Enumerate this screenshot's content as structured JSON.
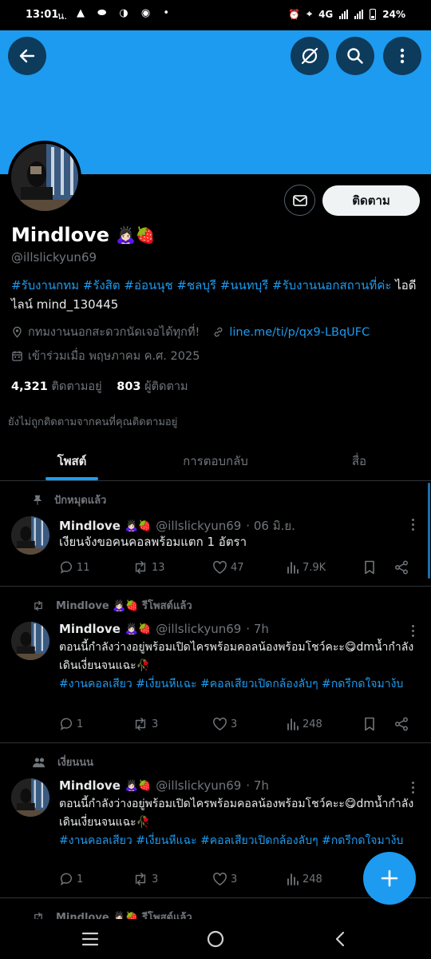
{
  "status": {
    "time": "13:01",
    "carrier_label": "น.",
    "network": "4G",
    "battery": "24%"
  },
  "profile": {
    "name": "Mindlove",
    "name_emoji": "🙇🏻‍♀️🍓",
    "handle": "@illslickyun69",
    "follow_label": "ติดตาม",
    "bio_tags": "#รับงานกทม #รังสิต #อ่อนนุช #ชลบุรี #นนทบุรี #รับงานนอกสถานที่ค่ะ",
    "bio_rest": " ไอดีไลน์ mind_130445",
    "location": "กทมงานนอกสะดวกนัดเจอได้ทุกที่!",
    "link": "line.me/ti/p/qx9-LBqUFC",
    "joined": "เข้าร่วมเมื่อ พฤษภาคม ค.ศ. 2025",
    "following_count": "4,321",
    "following_label": "ติดตามอยู่",
    "followers_count": "803",
    "followers_label": "ผู้ติดตาม",
    "not_followed_note": "ยังไม่ถูกติดตามจากคนที่คุณติดตามอยู่"
  },
  "tabs": [
    {
      "label": "โพสต์"
    },
    {
      "label": "การตอบกลับ"
    },
    {
      "label": "สื่อ"
    }
  ],
  "posts": [
    {
      "context": "ปักหมุดแล้ว",
      "name": "Mindlove",
      "emoji": "🙇🏻‍♀️🍓",
      "handle": "@illslickyun69",
      "time": "· 06 มิ.ย.",
      "text": "เงียนจังขอคนคอลพร้อมแตก 1 อัตรา",
      "tags": "",
      "replies": "11",
      "reposts": "13",
      "likes": "47",
      "views": "7.9K"
    },
    {
      "context": "Mindlove 🙇🏻‍♀️🍓 รีโพสต์แล้ว",
      "name": "Mindlove",
      "emoji": "🙇🏻‍♀️🍓",
      "handle": "@illslickyun69",
      "time": "· 7h",
      "text": "ตอนนี้กำลังว่างอยู่พร้อมเปิดไครพร้อมคอลน้องพร้อมโชว์คะะ😋dmน้ำกำลังเดินเงี่ยนจนแฉะ🥀",
      "tags": "#งานคอลเสียว #เงี่ยนหีแฉะ #คอลเสียวเปิดกล้องลับๆ #กดรีกดใจมาง้บ",
      "replies": "1",
      "reposts": "3",
      "likes": "3",
      "views": "248"
    },
    {
      "context": "เงี่ยนนน",
      "name": "Mindlove",
      "emoji": "🙇🏻‍♀️🍓",
      "handle": "@illslickyun69",
      "time": "· 7h",
      "text": "ตอนนี้กำลังว่างอยู่พร้อมเปิดไครพร้อมคอลน้องพร้อมโชว์คะะ😋dmน้ำกำลังเดินเงี่ยนจนแฉะ🥀",
      "tags": "#งานคอลเสียว #เงี่ยนหีแฉะ #คอลเสียวเปิดกล้องลับๆ #กดรีกดใจมาง้บ",
      "replies": "1",
      "reposts": "3",
      "likes": "3",
      "views": "248"
    },
    {
      "context": "Mindlove 🙇🏻‍♀️🍓 รีโพสต์แล้ว"
    }
  ],
  "colors": {
    "accent": "#1d9bf0",
    "banner": "#1d9bf0",
    "background": "#000000",
    "muted": "#71767b"
  }
}
